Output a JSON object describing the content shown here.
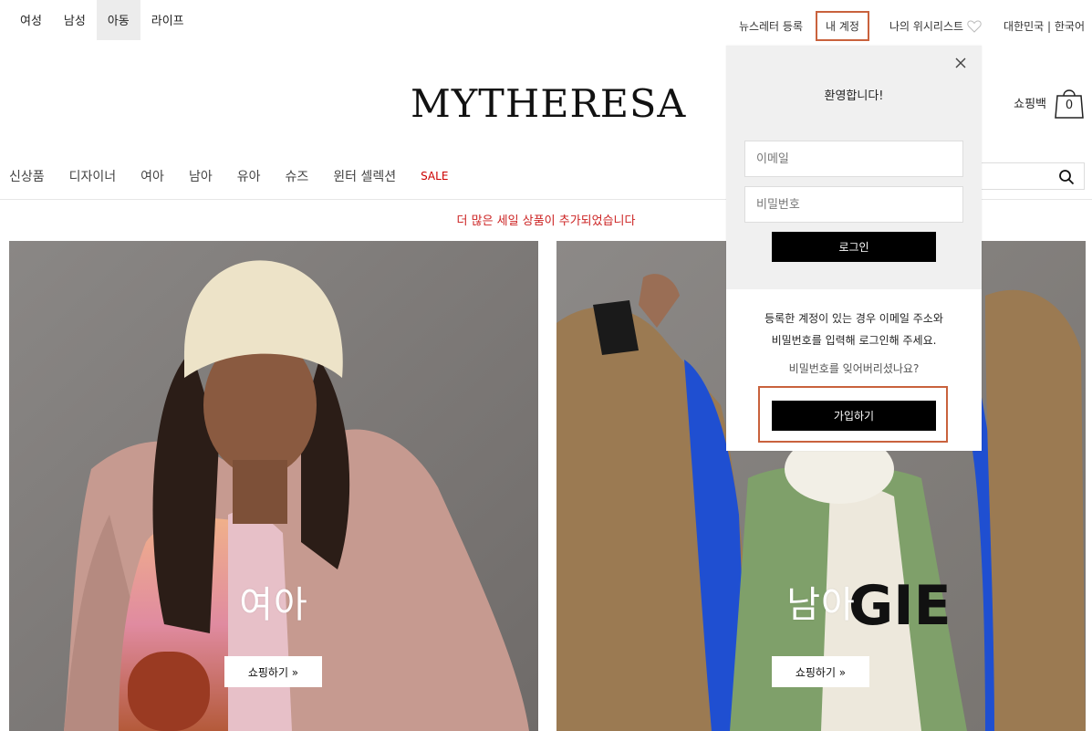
{
  "gender_nav": [
    "여성",
    "남성",
    "아동",
    "라이프"
  ],
  "gender_active": "아동",
  "util": {
    "newsletter": "뉴스레터 등록",
    "account": "내 계정",
    "wishlist": "나의 위시리스트",
    "region": "대한민국 | 한국어"
  },
  "logo": "MYTHERESA",
  "cart": {
    "label": "쇼핑백",
    "count": "0"
  },
  "main_nav": [
    "신상품",
    "디자이너",
    "여아",
    "남아",
    "유아",
    "슈즈",
    "윈터 셀렉션"
  ],
  "sale_label": "SALE",
  "banner": "더 많은 세일 상품이 추가되었습니다",
  "heroes": [
    {
      "label": "여아",
      "button": "쇼핑하기 »"
    },
    {
      "label": "남아",
      "button": "쇼핑하기 »"
    }
  ],
  "popup": {
    "welcome": "환영합니다!",
    "email_placeholder": "이메일",
    "password_placeholder": "비밀번호",
    "login_button": "로그인",
    "info_line1": "등록한 계정이 있는 경우 이메일 주소와",
    "info_line2": "비밀번호를 입력해 로그인해 주세요.",
    "forgot": "비밀번호를 잊어버리셨나요?",
    "signup_button": "가입하기"
  },
  "colors": {
    "sale": "#cc0000",
    "highlight": "#c9623d",
    "button": "#000000"
  },
  "icons": [
    "heart-icon",
    "bag-icon",
    "search-icon",
    "close-icon"
  ]
}
